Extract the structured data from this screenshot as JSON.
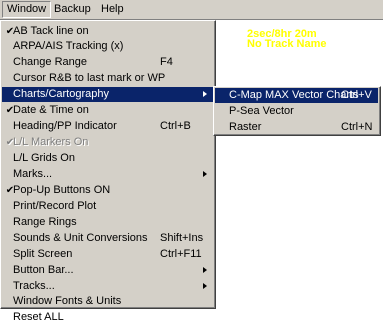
{
  "menubar": {
    "items": [
      {
        "label": "Window"
      },
      {
        "label": "Backup"
      },
      {
        "label": "Help"
      }
    ]
  },
  "overlay": {
    "line1": "2sec/8hr 20m",
    "line2": "No Track Name"
  },
  "window_menu": {
    "items": [
      {
        "check": "✔",
        "label": "AB Tack line on",
        "shortcut": ""
      },
      {
        "check": "",
        "label": "ARPA/AIS Tracking (x)",
        "shortcut": ""
      },
      {
        "check": "",
        "label": "Change Range",
        "shortcut": "F4"
      },
      {
        "check": "",
        "label": "Cursor R&B to last mark or WP",
        "shortcut": ""
      },
      {
        "check": "",
        "label": "Charts/Cartography",
        "shortcut": ""
      },
      {
        "check": "✔",
        "label": "Date & Time on",
        "shortcut": ""
      },
      {
        "check": "",
        "label": "Heading/PP Indicator",
        "shortcut": "Ctrl+B"
      },
      {
        "check": "✔",
        "label": "L/L Markers On",
        "shortcut": ""
      },
      {
        "check": "",
        "label": "L/L Grids On",
        "shortcut": ""
      },
      {
        "check": "",
        "label": "Marks...",
        "shortcut": ""
      },
      {
        "check": "✔",
        "label": "Pop-Up Buttons ON",
        "shortcut": ""
      },
      {
        "check": "",
        "label": "Print/Record Plot",
        "shortcut": ""
      },
      {
        "check": "",
        "label": "Range Rings",
        "shortcut": ""
      },
      {
        "check": "",
        "label": "Sounds & Unit Conversions",
        "shortcut": "Shift+Ins"
      },
      {
        "check": "",
        "label": "Split Screen",
        "shortcut": "Ctrl+F11"
      },
      {
        "check": "",
        "label": "Button Bar...",
        "shortcut": ""
      },
      {
        "check": "",
        "label": "Tracks...",
        "shortcut": ""
      },
      {
        "check": "",
        "label": "Window Fonts & Units",
        "shortcut": ""
      },
      {
        "check": "",
        "label": "Reset ALL",
        "shortcut": ""
      }
    ]
  },
  "charts_submenu": {
    "items": [
      {
        "label": "C-Map MAX Vector Charts",
        "shortcut": "Ctrl+V"
      },
      {
        "label": "P-Sea Vector",
        "shortcut": ""
      },
      {
        "label": "Raster",
        "shortcut": "Ctrl+N"
      }
    ]
  }
}
